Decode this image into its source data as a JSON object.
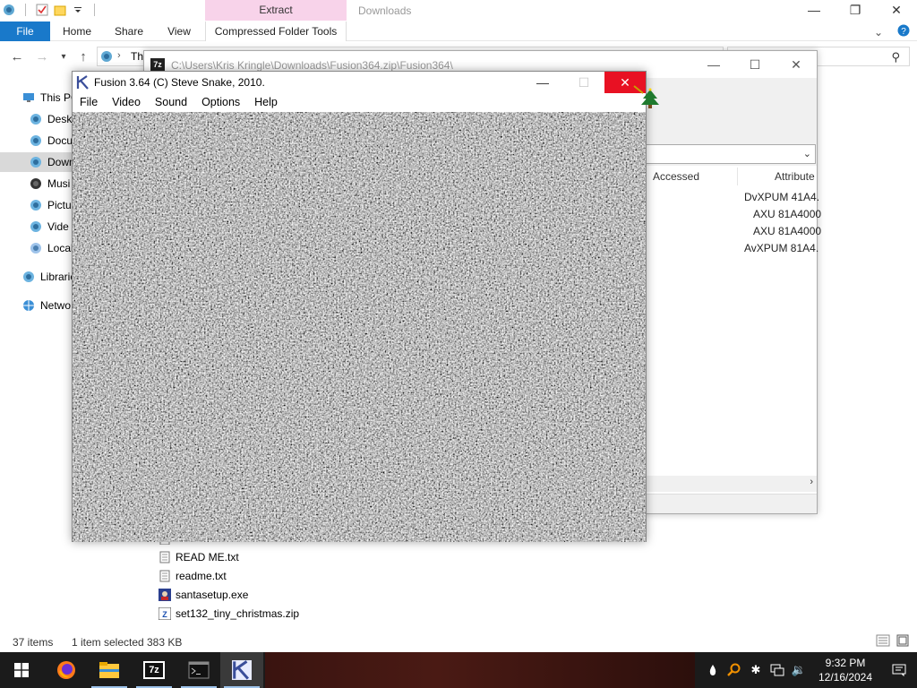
{
  "explorer": {
    "context_tab_header": "Extract",
    "window_title": "Downloads",
    "ribbon_tabs": {
      "file": "File",
      "home": "Home",
      "share": "Share",
      "view": "View",
      "context": "Compressed Folder Tools"
    },
    "address_text": "Th",
    "search_placeholder": "s",
    "nav_items": [
      "This PC",
      "Deskt",
      "Docu",
      "Down",
      "Musi",
      "Pictu",
      "Vide",
      "Local",
      "Librarie",
      "Netwo"
    ],
    "files": [
      "READ ME.txt",
      "readme.txt",
      "santasetup.exe",
      "set132_tiny_christmas.zip"
    ],
    "status": {
      "count": "37 items",
      "selection": "1 item selected",
      "size": "383 KB"
    }
  },
  "sevenzip": {
    "title": "C:\\Users\\Kris Kringle\\Downloads\\Fusion364.zip\\Fusion364\\",
    "logo": "7z",
    "columns": {
      "accessed": "Accessed",
      "attributes": "Attribute"
    },
    "rows": [
      "DvXPUM 41A4.",
      "AXU 81A4000",
      "AXU 81A4000",
      "AvXPUM 81A4."
    ]
  },
  "fusion": {
    "title": "Fusion 3.64 (C) Steve Snake, 2010.",
    "menu": [
      "File",
      "Video",
      "Sound",
      "Options",
      "Help"
    ]
  },
  "taskbar": {
    "time": "9:32 PM",
    "date": "12/16/2024",
    "sevenzip_label": "7z"
  }
}
